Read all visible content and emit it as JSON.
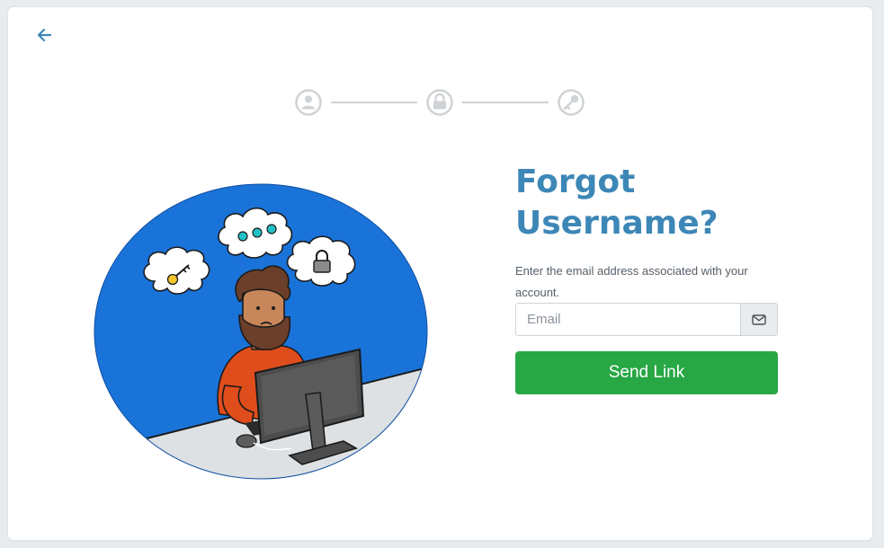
{
  "nav": {
    "back_icon": "arrow-left-icon"
  },
  "stepper": {
    "steps": [
      {
        "icon": "user-icon",
        "state": "inactive"
      },
      {
        "icon": "lock-icon",
        "state": "inactive"
      },
      {
        "icon": "key-icon",
        "state": "inactive"
      }
    ],
    "inactive_color": "#cfd3d6"
  },
  "form": {
    "title": "Forgot Username?",
    "subtitle": "Enter the email address associated with your account.",
    "email_placeholder": "Email",
    "email_value": "",
    "email_addon_icon": "envelope-icon",
    "submit_label": "Send Link"
  },
  "colors": {
    "title": "#3d87b7",
    "submit": "#28a745",
    "back_arrow": "#3d87b7",
    "illustration_sky": "#1a73d9"
  }
}
